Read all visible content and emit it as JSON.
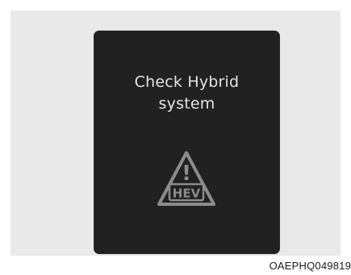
{
  "display": {
    "message_line1": "Check Hybrid",
    "message_line2": "system",
    "icon": "hev-warning-triangle-icon",
    "icon_label": "HEV",
    "icon_mark": "!"
  },
  "figure_code": "OAEPHQ049819",
  "colors": {
    "panel_background": "#e9e9e9",
    "display_background": "#212121",
    "message_text": "#e4e4e4",
    "icon": "#8c8c8c"
  }
}
